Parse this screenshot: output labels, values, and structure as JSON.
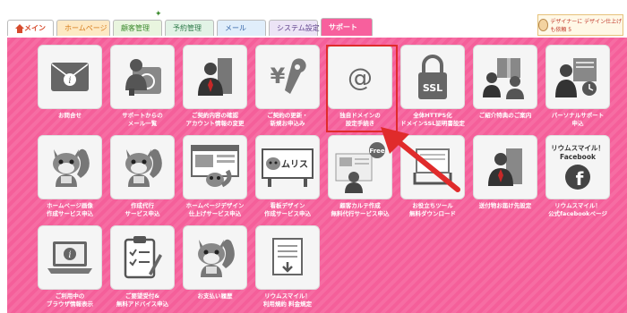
{
  "tabs": [
    {
      "label": "メイン",
      "name": "main"
    },
    {
      "label": "ホームページ",
      "name": "homepage"
    },
    {
      "label": "顧客管理",
      "name": "customer"
    },
    {
      "label": "予約管理",
      "name": "reservation"
    },
    {
      "label": "メール",
      "name": "mail"
    },
    {
      "label": "システム設定",
      "name": "system"
    },
    {
      "label": "サポート",
      "name": "support"
    }
  ],
  "banner": {
    "text": "デザイナーに デザイン仕上げも依頼 5"
  },
  "tiles": [
    {
      "label": "お問合せ",
      "icon": "envelope-icon"
    },
    {
      "label": "サポートからの\nメール一覧",
      "icon": "support-mail-icon"
    },
    {
      "label": "ご契約内容の確認\nアカウント情報の変更",
      "icon": "contract-person-icon"
    },
    {
      "label": "ご契約の更新・\n新規お申込み",
      "icon": "yen-wrench-icon"
    },
    {
      "label": "独自ドメインの\n設定手続き",
      "icon": "at-sign-icon"
    },
    {
      "label": "全体HTTPS化\nドメインSSL証明書設定",
      "icon": "ssl-lock-icon"
    },
    {
      "label": "ご紹介特典のご案内",
      "icon": "referral-gift-icon"
    },
    {
      "label": "パーソナルサポート\n申込",
      "icon": "personal-support-icon"
    },
    {
      "label": "ホームページ画像\n作成サービス申込",
      "icon": "squirrel-mascot-icon"
    },
    {
      "label": "作成代行\nサービス申込",
      "icon": "squirrel-mascot-icon"
    },
    {
      "label": "ホームページデザイン\n仕上げサービス申込",
      "icon": "browser-squirrel-icon"
    },
    {
      "label": "看板デザイン\n作成サービス申込",
      "icon": "signboard-squirrel-icon"
    },
    {
      "label": "顧客カルテ作成\n無料代行サービス申込",
      "icon": "free-karte-icon"
    },
    {
      "label": "お役立ちツール\n無料ダウンロード",
      "icon": "download-tray-icon"
    },
    {
      "label": "送付物お届け先設定",
      "icon": "delivery-person-icon"
    },
    {
      "label": "リウムスマイル！\n公式facebookページ",
      "icon": "facebook-icon"
    },
    {
      "label": "ご利用中の\nブラウザ情報表示",
      "icon": "laptop-info-icon"
    },
    {
      "label": "ご要望受付&\n無料アドバイス申込",
      "icon": "clipboard-pen-icon"
    },
    {
      "label": "お支払い履歴",
      "icon": "squirrel-mascot-icon"
    },
    {
      "label": "リウムスマイル！\n利用規約 料金規定",
      "icon": "document-icon"
    }
  ],
  "card_text": {
    "ssl": "SSL",
    "facebook_title": "リウムスマイル！\nFacebook",
    "signboard": "ムリス",
    "free": "Free"
  },
  "colors": {
    "accent": "#f55f9a",
    "highlight": "#e02b2b",
    "tile_bg": "#f5f5f5",
    "icon": "#555555"
  }
}
